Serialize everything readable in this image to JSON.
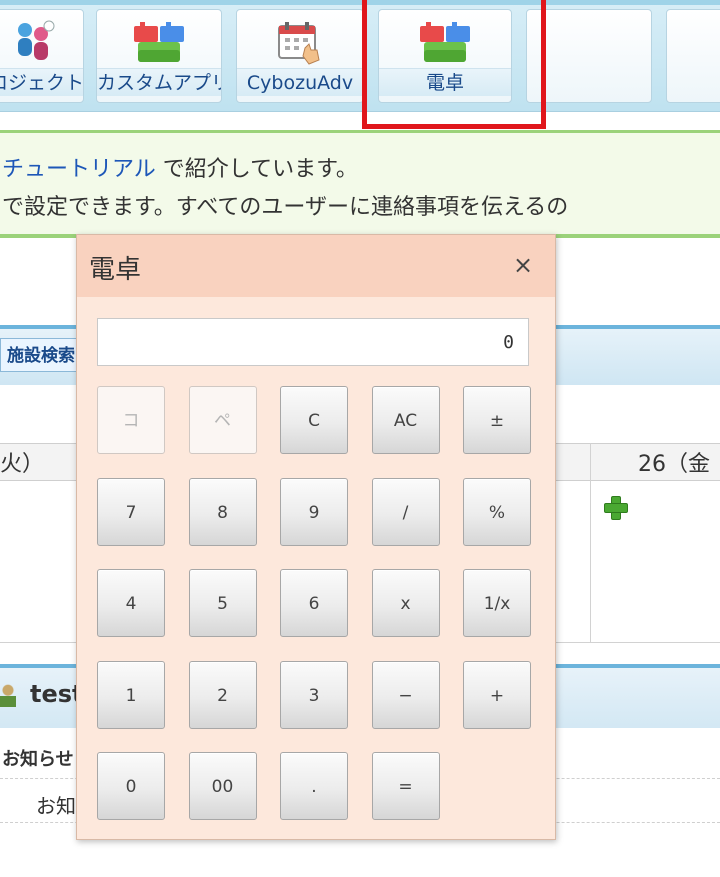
{
  "app_bar": {
    "tiles": [
      {
        "label": "ロジェクト",
        "icon": "people-icon"
      },
      {
        "label": "カスタムアプリ",
        "icon": "blocks-icon"
      },
      {
        "label": "CybozuAdv",
        "icon": "calendar-hand-icon"
      },
      {
        "label": "電卓",
        "icon": "blocks-icon"
      }
    ]
  },
  "banner": {
    "line1_link": "チュートリアル",
    "line1_rest": " で紹介しています。",
    "line2": "で設定できます。すべてのユーザーに連絡事項を伝えるの"
  },
  "background": {
    "facility_button": "施設検索",
    "cal_left": "火）",
    "cal_right": "26（金",
    "portlet_title": "test",
    "notice_label": "お知らせ",
    "notice_text": "お知"
  },
  "calculator": {
    "title": "電卓",
    "close": "×",
    "display": "0",
    "keys": [
      [
        "コ",
        "ペ",
        "C",
        "AC",
        "±"
      ],
      [
        "7",
        "8",
        "9",
        "/",
        "%"
      ],
      [
        "4",
        "5",
        "6",
        "x",
        "1/x"
      ],
      [
        "1",
        "2",
        "3",
        "−",
        "+"
      ],
      [
        "0",
        "00",
        ".",
        "="
      ]
    ]
  },
  "colors": {
    "highlight": "#e0161c",
    "dialog_bg": "#fde8dc",
    "dialog_title_bg": "#f9d2bf",
    "banner_border": "#9bd27a",
    "link": "#1d57b8"
  }
}
